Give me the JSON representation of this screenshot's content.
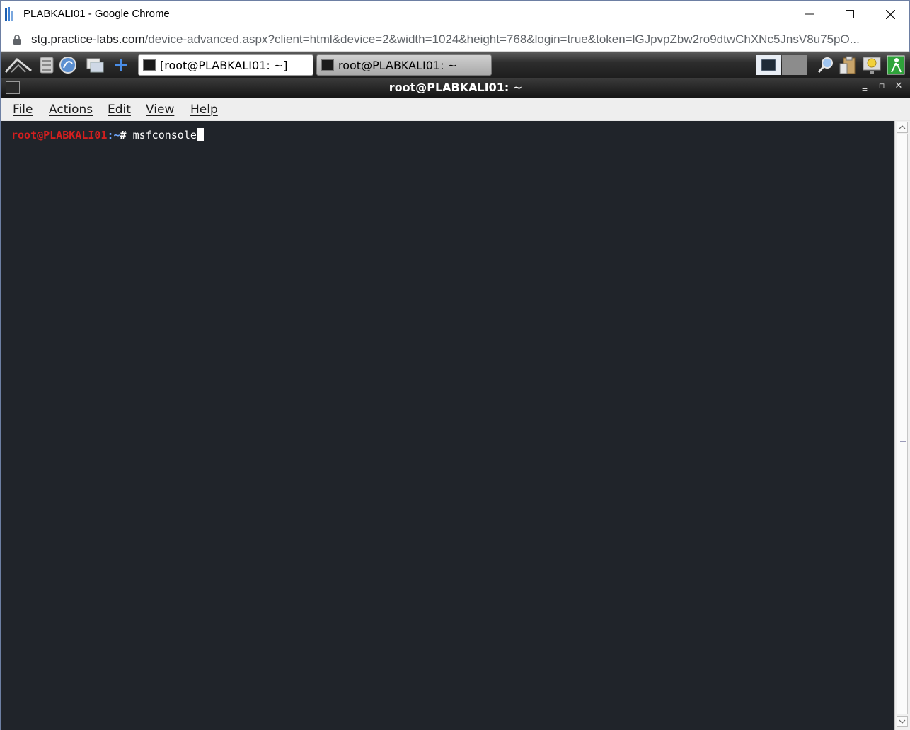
{
  "browser": {
    "window_title": "PLABKALI01 - Google Chrome",
    "url_domain": "stg.practice-labs.com",
    "url_path": "/device-advanced.aspx?client=html&device=2&width=1024&height=768&login=true&token=lGJpvpZbw2ro9dtwChXNc5JnsV8u75pO..."
  },
  "remote_desktop": {
    "taskbar": {
      "launcher_icons": [
        "kali-logo-icon",
        "file-manager-icon",
        "browser-icon",
        "show-desktop-icon",
        "add-icon"
      ],
      "tasks": [
        {
          "label": "[root@PLABKALI01: ~]",
          "active": true
        },
        {
          "label": "root@PLABKALI01: ~",
          "active": false
        }
      ],
      "tray_icons": [
        "workspace-icon",
        "search-icon",
        "clipboard-icon",
        "notification-icon",
        "logout-icon"
      ]
    },
    "terminal": {
      "title": "root@PLABKALI01: ~",
      "menu": [
        "File",
        "Actions",
        "Edit",
        "View",
        "Help"
      ],
      "prompt_user": "root@PLABKALI01",
      "prompt_sep": ":~",
      "prompt_hash": "#",
      "command": " msfconsole"
    }
  },
  "colors": {
    "terminal_bg": "#20242a",
    "prompt_user": "#d21f1f",
    "prompt_path": "#6fa8ff"
  }
}
